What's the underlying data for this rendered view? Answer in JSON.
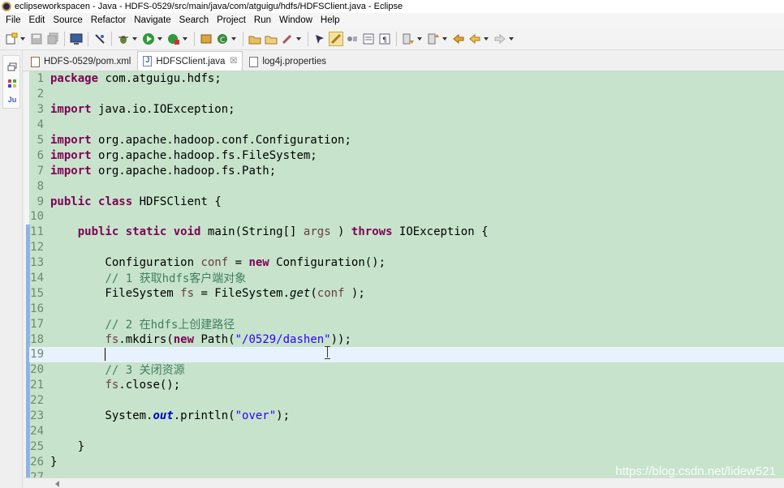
{
  "window": {
    "title": "eclipseworkspacen - Java - HDFS-0529/src/main/java/com/atguigu/hdfs/HDFSClient.java - Eclipse"
  },
  "menu": [
    "File",
    "Edit",
    "Source",
    "Refactor",
    "Navigate",
    "Search",
    "Project",
    "Run",
    "Window",
    "Help"
  ],
  "left_trim": {
    "icons": [
      "restore-icon",
      "outline-icon",
      "junit-icon"
    ],
    "junit_label": "Ju"
  },
  "tabs": [
    {
      "label": "HDFS-0529/pom.xml",
      "icon": "xml-file-icon",
      "active": false
    },
    {
      "label": "HDFSClient.java",
      "icon": "java-file-icon",
      "active": true,
      "close": "☒"
    },
    {
      "label": "log4j.properties",
      "icon": "properties-file-icon",
      "active": false
    }
  ],
  "editor": {
    "current_line": 19,
    "lines": [
      {
        "n": "1",
        "tokens": [
          [
            "kw",
            "package"
          ],
          [
            "",
            " com.atguigu.hdfs;"
          ]
        ]
      },
      {
        "n": "2",
        "tokens": []
      },
      {
        "n": "3",
        "tokens": [
          [
            "kw",
            "import"
          ],
          [
            "",
            " java.io.IOException;"
          ]
        ]
      },
      {
        "n": "4",
        "tokens": []
      },
      {
        "n": "5",
        "tokens": [
          [
            "kw",
            "import"
          ],
          [
            "",
            " org.apache.hadoop.conf.Configuration;"
          ]
        ]
      },
      {
        "n": "6",
        "tokens": [
          [
            "kw",
            "import"
          ],
          [
            "",
            " org.apache.hadoop.fs.FileSystem;"
          ]
        ]
      },
      {
        "n": "7",
        "tokens": [
          [
            "kw",
            "import"
          ],
          [
            "",
            " org.apache.hadoop.fs.Path;"
          ]
        ]
      },
      {
        "n": "8",
        "tokens": []
      },
      {
        "n": "9",
        "tokens": [
          [
            "kw",
            "public"
          ],
          [
            "",
            " "
          ],
          [
            "kw",
            "class"
          ],
          [
            "",
            " HDFSClient {"
          ]
        ]
      },
      {
        "n": "10",
        "tokens": []
      },
      {
        "n": "11",
        "tokens": [
          [
            "",
            "    "
          ],
          [
            "kw",
            "public"
          ],
          [
            "",
            " "
          ],
          [
            "kw",
            "static"
          ],
          [
            "",
            " "
          ],
          [
            "kw",
            "void"
          ],
          [
            "",
            " main(String[] "
          ],
          [
            "var",
            "args"
          ],
          [
            "",
            " ) "
          ],
          [
            "kw",
            "throws"
          ],
          [
            "",
            " IOException {"
          ]
        ]
      },
      {
        "n": "12",
        "tokens": []
      },
      {
        "n": "13",
        "tokens": [
          [
            "",
            "        Configuration "
          ],
          [
            "var",
            "conf"
          ],
          [
            "",
            " = "
          ],
          [
            "kw",
            "new"
          ],
          [
            "",
            " Configuration();"
          ]
        ]
      },
      {
        "n": "14",
        "tokens": [
          [
            "",
            "        "
          ],
          [
            "cmt",
            "// 1 获取hdfs客户端对象"
          ]
        ]
      },
      {
        "n": "15",
        "tokens": [
          [
            "",
            "        FileSystem "
          ],
          [
            "var",
            "fs"
          ],
          [
            "",
            " = FileSystem."
          ],
          [
            "ital",
            "get"
          ],
          [
            "",
            "("
          ],
          [
            "var",
            "conf"
          ],
          [
            "",
            " );"
          ]
        ]
      },
      {
        "n": "16",
        "tokens": []
      },
      {
        "n": "17",
        "tokens": [
          [
            "",
            "        "
          ],
          [
            "cmt",
            "// 2 在hdfs上创建路径"
          ]
        ]
      },
      {
        "n": "18",
        "tokens": [
          [
            "",
            "        "
          ],
          [
            "var",
            "fs"
          ],
          [
            "",
            ".mkdirs("
          ],
          [
            "kw",
            "new"
          ],
          [
            "",
            " Path("
          ],
          [
            "str",
            "\"/0529/dashen\""
          ],
          [
            "",
            "));"
          ]
        ]
      },
      {
        "n": "19",
        "tokens": [
          [
            "",
            "        "
          ]
        ],
        "caret": true
      },
      {
        "n": "20",
        "tokens": [
          [
            "",
            "        "
          ],
          [
            "cmt",
            "// 3 关闭资源"
          ]
        ]
      },
      {
        "n": "21",
        "tokens": [
          [
            "",
            "        "
          ],
          [
            "var",
            "fs"
          ],
          [
            "",
            ".close();"
          ]
        ]
      },
      {
        "n": "22",
        "tokens": []
      },
      {
        "n": "23",
        "tokens": [
          [
            "",
            "        System."
          ],
          [
            "stat",
            "out"
          ],
          [
            "",
            ".println("
          ],
          [
            "str",
            "\"over\""
          ],
          [
            "",
            ");"
          ]
        ]
      },
      {
        "n": "24",
        "tokens": []
      },
      {
        "n": "25",
        "tokens": [
          [
            "",
            "    }"
          ]
        ]
      },
      {
        "n": "26",
        "tokens": [
          [
            "",
            "}"
          ]
        ]
      },
      {
        "n": "27",
        "tokens": []
      }
    ]
  },
  "watermark": "https://blog.csdn.net/lidew521",
  "colors": {
    "editor_bg": "#c7e3cc",
    "keyword": "#7f0055",
    "string": "#2a00ff",
    "comment": "#3f7f5f"
  }
}
